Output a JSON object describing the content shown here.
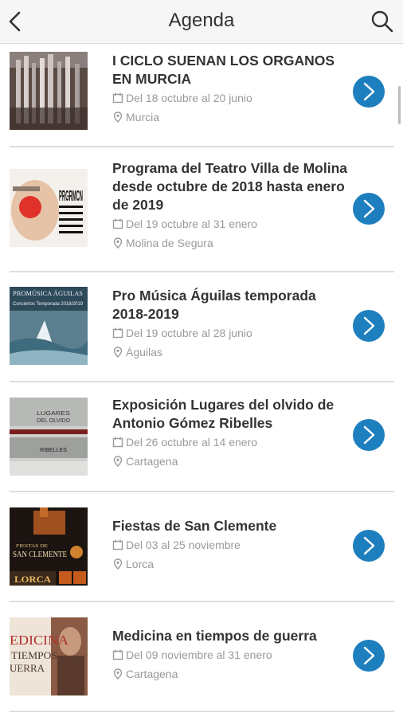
{
  "header": {
    "title": "Agenda",
    "back_icon": "chevron-left-icon",
    "search_icon": "search-icon"
  },
  "events": [
    {
      "title": "I CICLO SUENAN LOS ORGANOS EN MURCIA",
      "date": "Del 18 octubre al 20 junio",
      "location": "Murcia"
    },
    {
      "title": "Programa del Teatro Villa de Molina desde octubre de 2018 hasta enero de 2019",
      "date": "Del 19 octubre al 31 enero",
      "location": "Molina de Segura"
    },
    {
      "title": "Pro Música Águilas temporada 2018-2019",
      "date": "Del 19 octubre al 28 junio",
      "location": "Águilas"
    },
    {
      "title": "Exposición Lugares del olvido de Antonio Gómez Ribelles",
      "date": "Del 26 octubre al 14 enero",
      "location": "Cartagena"
    },
    {
      "title": "Fiestas de San Clemente",
      "date": "Del 03 al 25 noviembre",
      "location": "Lorca"
    },
    {
      "title": "Medicina en tiempos de guerra",
      "date": "Del 09 noviembre al 31 enero",
      "location": "Cartagena"
    }
  ],
  "thumb_text": {
    "t2": "PRGRMCN",
    "t3a": "PROMÚSICA ÁGUILAS",
    "t3b": "Conciertos Temporada 2018/2019",
    "t4a": "LUGARES",
    "t4b": "DEL OLVIDO",
    "t4c": "RIBELLES",
    "t5a": "FIESTAS DE",
    "t5b": "SAN CLEMENTE",
    "t5c": "LORCA",
    "t6a": "EDICINA",
    "t6b": "TIEMPOS",
    "t6c": "UERRA"
  },
  "colors": {
    "accent": "#1e7fbf",
    "header_bg": "#f6f6f6",
    "meta_text": "#9a9a9a"
  }
}
